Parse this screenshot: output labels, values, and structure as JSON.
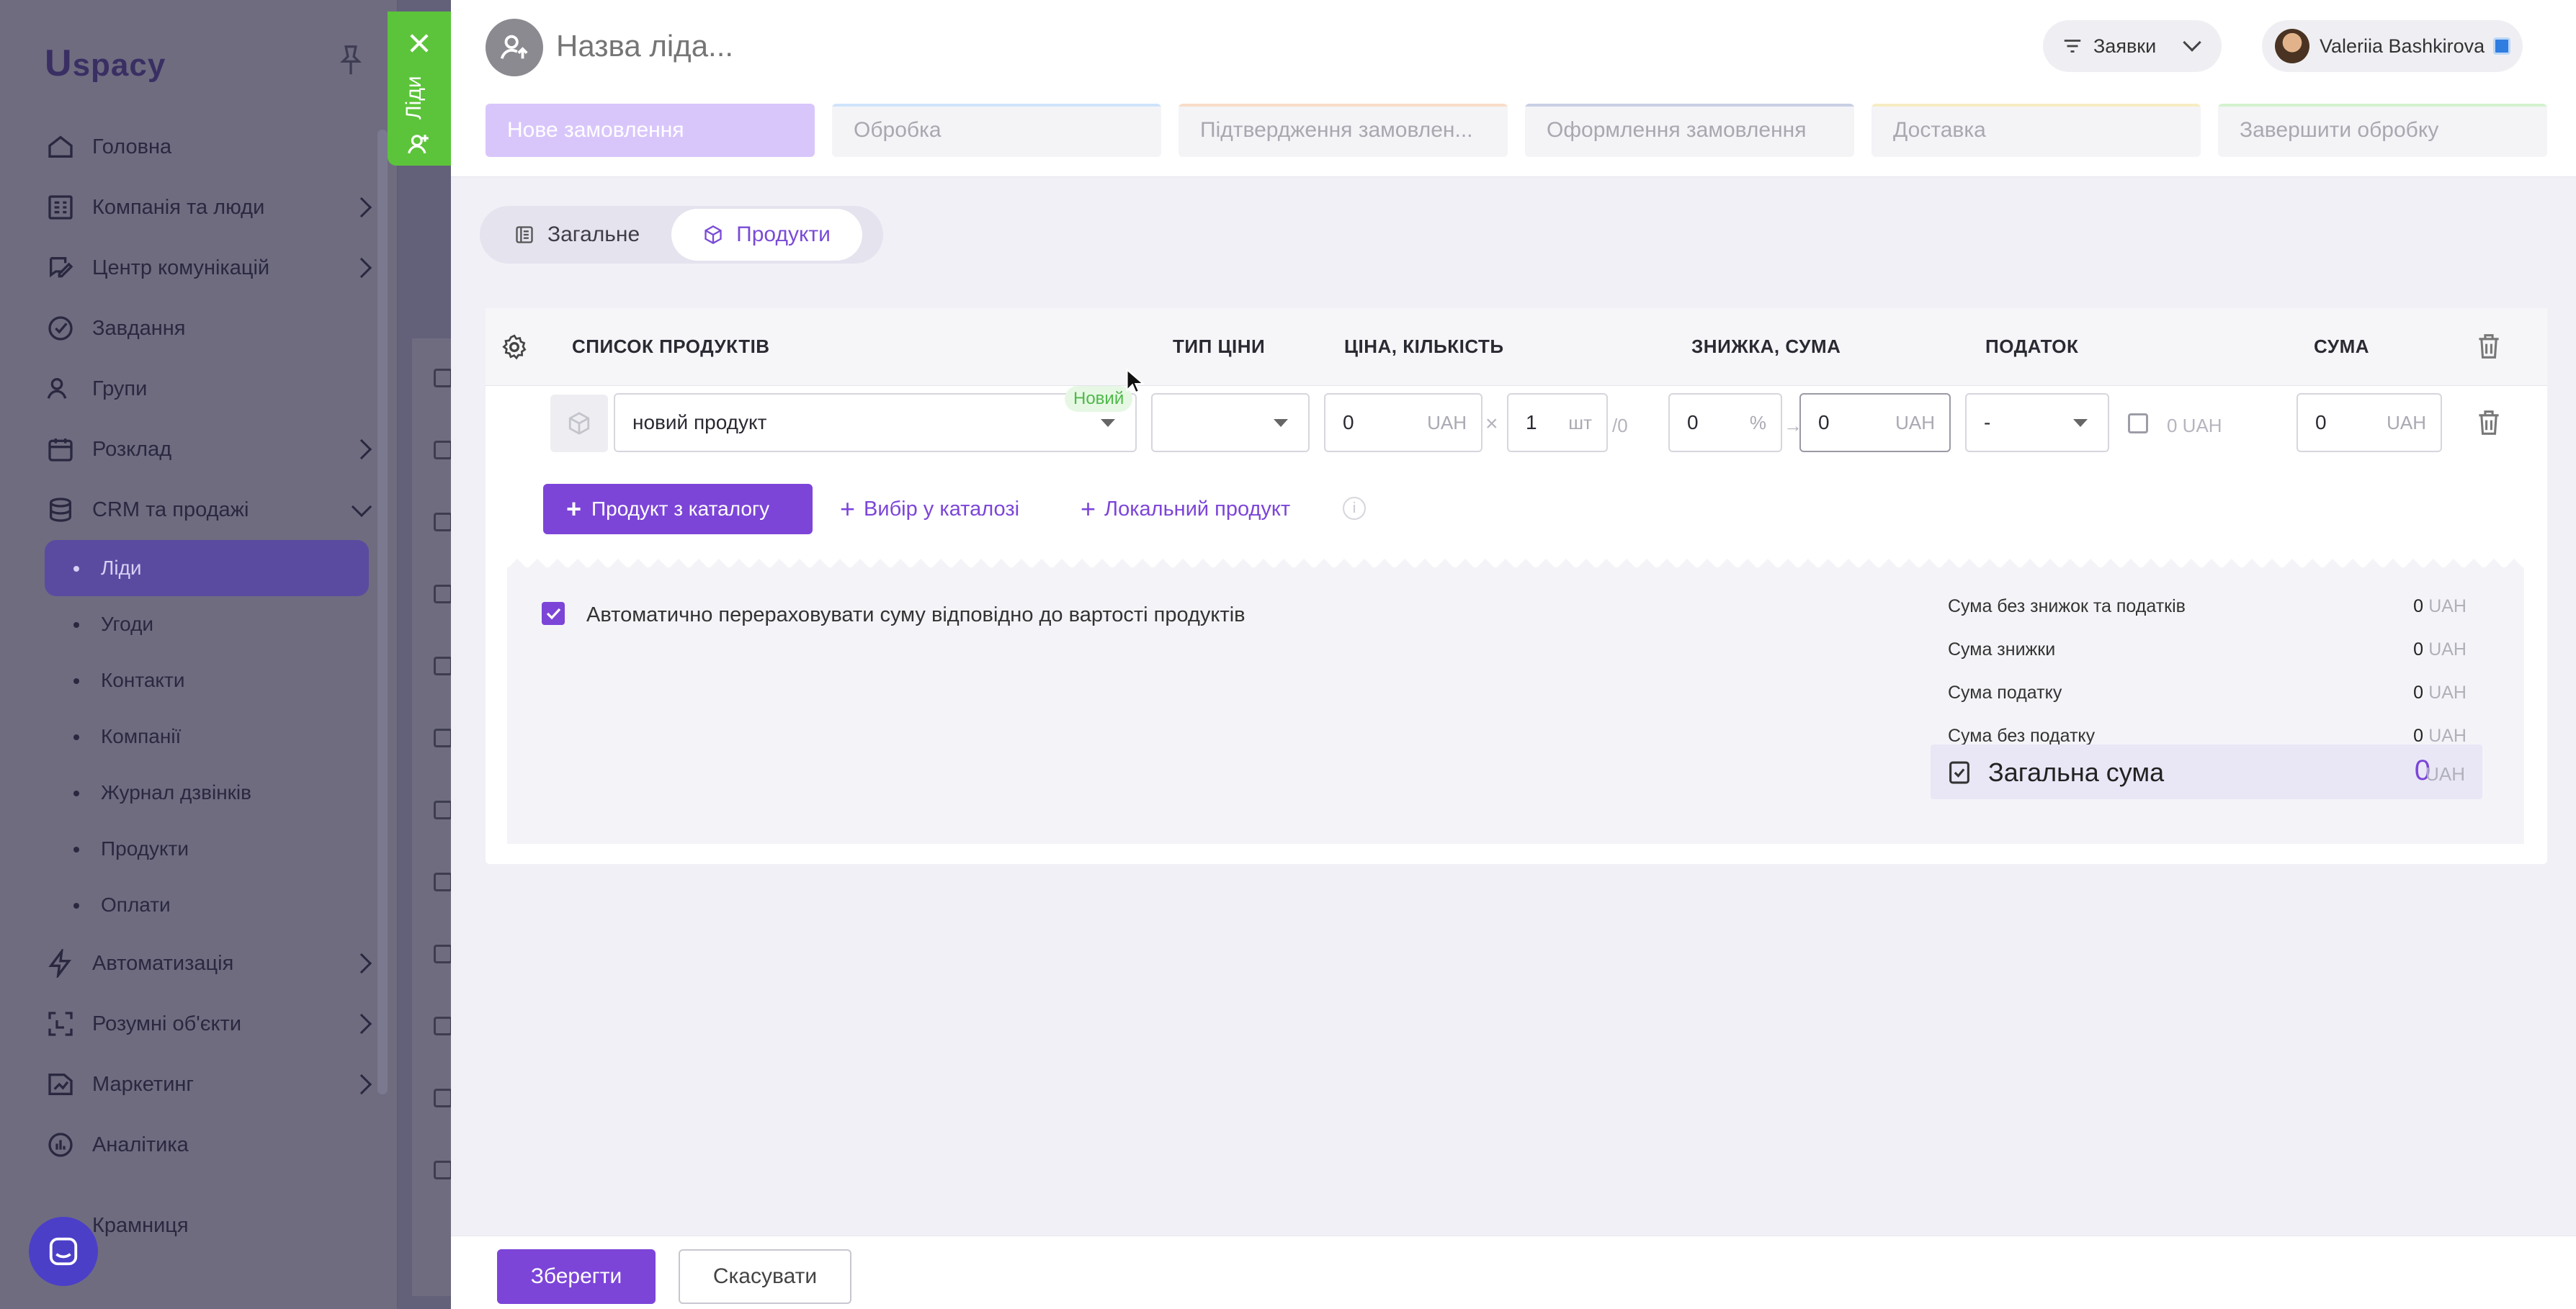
{
  "sidebar": {
    "logo_u": "U",
    "logo_text": "spacy",
    "items": [
      {
        "label": "Головна",
        "icon": "home-icon",
        "chevron": false
      },
      {
        "label": "Компанія та люди",
        "icon": "company-icon",
        "chevron": true
      },
      {
        "label": "Центр комунікацій",
        "icon": "chat-edit-icon",
        "chevron": true
      },
      {
        "label": "Завдання",
        "icon": "check-circle-icon",
        "chevron": false
      },
      {
        "label": "Групи",
        "icon": "users-icon",
        "chevron": false
      },
      {
        "label": "Розклад",
        "icon": "calendar-icon",
        "chevron": true
      },
      {
        "label": "CRM та продажі",
        "icon": "database-icon",
        "chevron": "down"
      }
    ],
    "sub_items": [
      {
        "label": "Ліди",
        "active": true
      },
      {
        "label": "Угоди"
      },
      {
        "label": "Контакти"
      },
      {
        "label": "Компанії"
      },
      {
        "label": "Журнал дзвінків"
      },
      {
        "label": "Продукти"
      },
      {
        "label": "Оплати"
      }
    ],
    "items_after": [
      {
        "label": "Автоматизація",
        "icon": "bolt-icon",
        "chevron": true
      },
      {
        "label": "Розумні об'єкти",
        "icon": "smart-object-icon",
        "chevron": true
      },
      {
        "label": "Маркетинг",
        "icon": "marketing-icon",
        "chevron": true
      },
      {
        "label": "Аналітика",
        "icon": "analytics-icon",
        "chevron": false
      }
    ],
    "shop_label": "Крамниця"
  },
  "side_tab": {
    "label": "Ліди"
  },
  "header": {
    "title_placeholder": "Назва ліда...",
    "filter_label": "Заявки",
    "user_name": "Valeriia Bashkirova",
    "stages": [
      "Нове замовлення",
      "Обробка",
      "Підтвердження замовлен...",
      "Оформлення замовлення",
      "Доставка",
      "Завершити обробку"
    ]
  },
  "tabs": [
    {
      "label": "Загальне",
      "active": false
    },
    {
      "label": "Продукти",
      "active": true
    }
  ],
  "table": {
    "headers": {
      "products": "СПИСОК ПРОДУКТІВ",
      "price_type": "ТИП ЦІНИ",
      "price_qty": "ЦІНА, КІЛЬКІСТЬ",
      "discount": "ЗНИЖКА, СУМА",
      "tax": "ПОДАТОК",
      "sum": "СУМА"
    },
    "row": {
      "product_name": "новий продукт",
      "badge": "Новий",
      "price": "0",
      "price_unit": "UAH",
      "times": "×",
      "qty": "1",
      "qty_unit": "шт",
      "stock": "/0",
      "discount": "0",
      "discount_unit": "%",
      "arrow": "→",
      "discount_sum": "0",
      "discount_sum_unit": "UAH",
      "tax": "-",
      "tax_amount": "0 UAH",
      "sum": "0",
      "sum_unit": "UAH"
    }
  },
  "actions": {
    "from_catalog": "Продукт з каталогу",
    "pick_catalog": "Вибір у каталозі",
    "local_product": "Локальний продукт"
  },
  "summary": {
    "auto_recalc": "Автоматично перераховувати суму відповідно до вартості продуктів",
    "rows": [
      {
        "label": "Сума без знижок та податків",
        "value": "0",
        "unit": "UAH"
      },
      {
        "label": "Сума знижки",
        "value": "0",
        "unit": "UAH"
      },
      {
        "label": "Сума податку",
        "value": "0",
        "unit": "UAH"
      },
      {
        "label": "Сума без податку",
        "value": "0",
        "unit": "UAH"
      }
    ],
    "total_label": "Загальна сума",
    "total_value": "0",
    "total_unit": "UAH"
  },
  "footer": {
    "save": "Зберегти",
    "cancel": "Скасувати"
  }
}
